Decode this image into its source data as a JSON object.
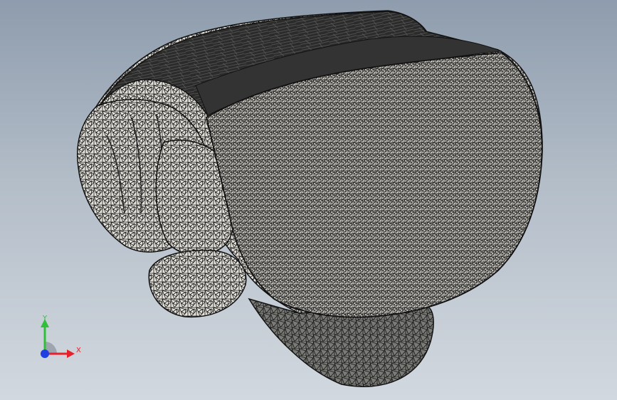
{
  "viewport": {
    "background_top": "#8e9cad",
    "background_bottom": "#d2d8df"
  },
  "model": {
    "icon": "mesh-model",
    "mesh_color": "#e2e0d8",
    "edge_color": "#111111"
  },
  "triad": {
    "x_label": "X",
    "y_label": "Y",
    "x_color": "#e8202a",
    "y_color": "#2fbf3a",
    "z_color": "#1f3fe0"
  }
}
